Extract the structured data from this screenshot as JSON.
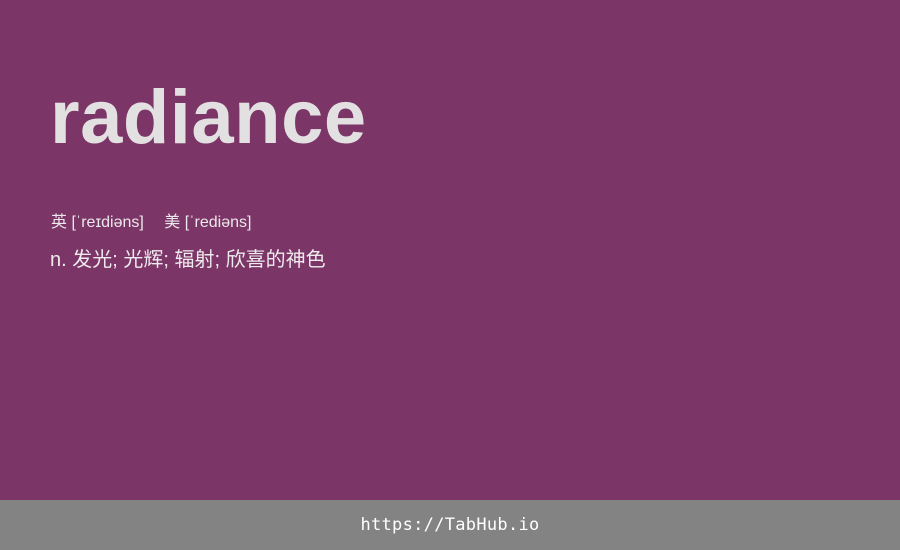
{
  "card": {
    "word": "radiance",
    "phonetic_uk": "英 [ˈreɪdiəns]",
    "phonetic_us": "美 [ˈrediəns]",
    "definition": "n. 发光; 光辉; 辐射; 欣喜的神色",
    "background_color": "#7b3566"
  },
  "footer": {
    "link_text": "https://TabHub.io",
    "background_color": "#838383"
  }
}
